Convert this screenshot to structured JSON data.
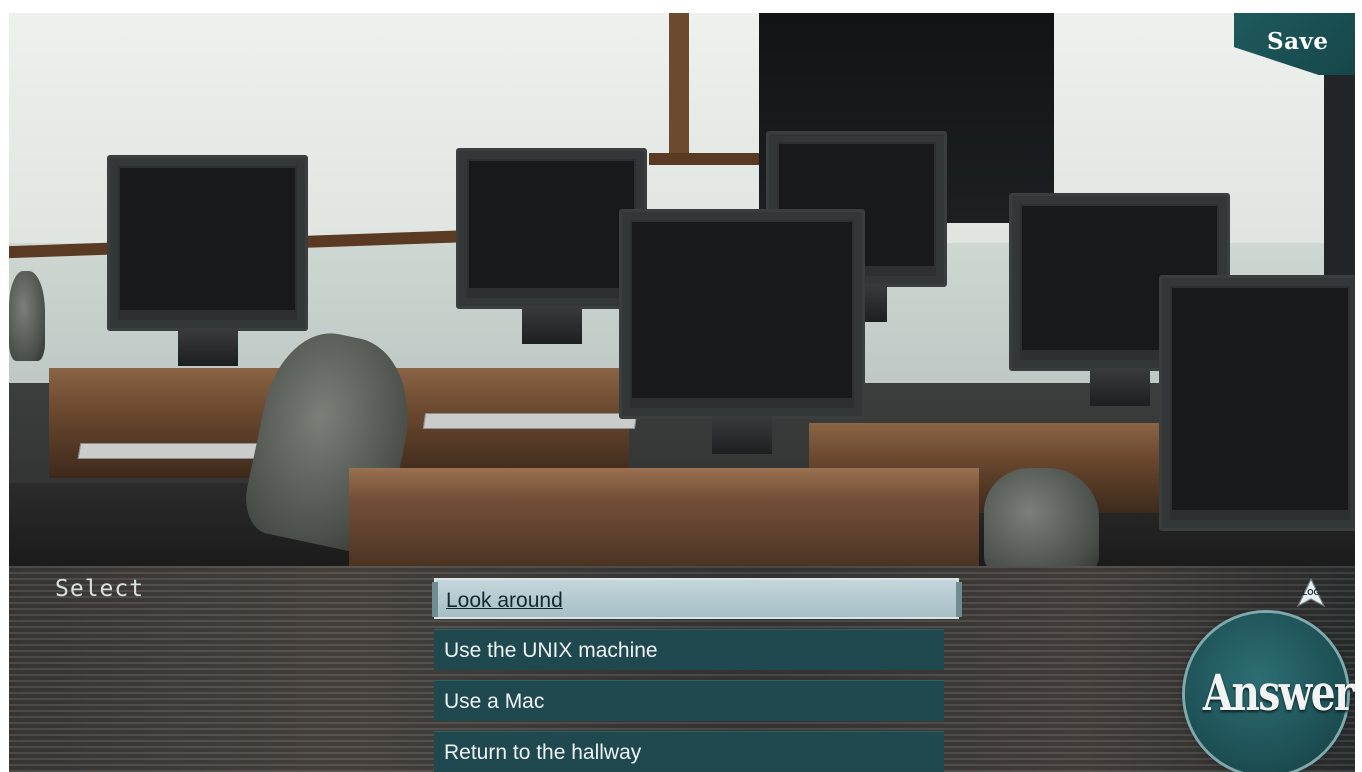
{
  "save": {
    "label": "Save"
  },
  "menu": {
    "title": "Select",
    "options": [
      {
        "label": "Look around",
        "selected": true
      },
      {
        "label": "Use the UNIX machine",
        "selected": false
      },
      {
        "label": "Use a Mac",
        "selected": false
      },
      {
        "label": "Return to the hallway",
        "selected": false
      }
    ]
  },
  "log": {
    "label": "LOG"
  },
  "answer": {
    "label": "Answer"
  },
  "colors": {
    "accent": "#1f5459",
    "option_bg": "#20484f",
    "selected_bg": "#b5cbd1"
  },
  "icons": {
    "log": "log-arrow-icon",
    "answer": "answer-emblem-icon"
  }
}
